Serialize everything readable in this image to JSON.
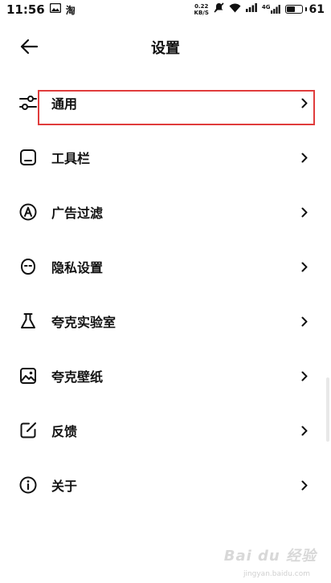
{
  "status_bar": {
    "time": "11:56",
    "left_icons": [
      "image-icon",
      "taobao-icon"
    ],
    "taobao_glyph": "淘",
    "net_speed_value": "0.22",
    "net_speed_unit": "KB/S",
    "signal_label": "4G",
    "battery_percent": "61",
    "battery_level": 0.61
  },
  "header": {
    "title": "设置",
    "back_icon": "arrow-left-icon"
  },
  "settings": {
    "items": [
      {
        "label": "通用",
        "icon": "sliders-icon"
      },
      {
        "label": "工具栏",
        "icon": "toolbar-icon"
      },
      {
        "label": "广告过滤",
        "icon": "ad-filter-icon"
      },
      {
        "label": "隐私设置",
        "icon": "privacy-mask-icon"
      },
      {
        "label": "夸克实验室",
        "icon": "flask-icon"
      },
      {
        "label": "夸克壁纸",
        "icon": "wallpaper-icon"
      },
      {
        "label": "反馈",
        "icon": "feedback-edit-icon"
      },
      {
        "label": "关于",
        "icon": "info-icon"
      }
    ],
    "chevron_icon": "chevron-right-icon"
  },
  "annotation": {
    "highlight_color": "#e03c3c"
  },
  "watermark": {
    "text": "Bai du 经验",
    "sub": "jingyan.baidu.com"
  }
}
